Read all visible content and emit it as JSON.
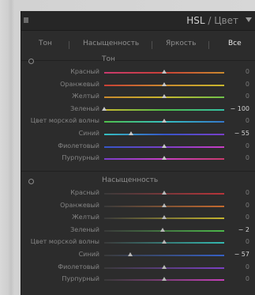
{
  "header": {
    "title": "HSL",
    "separator": "/",
    "subtitle": "Цвет"
  },
  "tabs": [
    {
      "label": "Тон",
      "active": false
    },
    {
      "label": "Насыщенность",
      "active": false
    },
    {
      "label": "Яркость",
      "active": false
    },
    {
      "label": "Все",
      "active": true
    }
  ],
  "sections": [
    {
      "title": "Тон",
      "rows": [
        {
          "label": "Красный",
          "value": "0",
          "level": 0,
          "gradient": [
            "#c93b6e",
            "#c94036",
            "#c98a2e"
          ]
        },
        {
          "label": "Оранжевый",
          "value": "0",
          "level": 0,
          "gradient": [
            "#c94036",
            "#c98a2e",
            "#c9b82e"
          ]
        },
        {
          "label": "Желтый",
          "value": "0",
          "level": 0,
          "gradient": [
            "#c98a2e",
            "#c9b82e",
            "#6fc24a"
          ]
        },
        {
          "label": "Зеленый",
          "value": "− 100",
          "level": -100,
          "gradient": [
            "#c9b82e",
            "#4fbf4a",
            "#35bfa5"
          ]
        },
        {
          "label": "Цвет морской волны",
          "value": "0",
          "level": 0,
          "gradient": [
            "#4fbf4a",
            "#35bfbf",
            "#3577c9"
          ]
        },
        {
          "label": "Синий",
          "value": "− 55",
          "level": -55,
          "gradient": [
            "#35bfbf",
            "#3556c9",
            "#7a3ec9"
          ]
        },
        {
          "label": "Фиолетовый",
          "value": "0",
          "level": 0,
          "gradient": [
            "#3556c9",
            "#7a3ec9",
            "#c93ec4"
          ]
        },
        {
          "label": "Пурпурный",
          "value": "0",
          "level": 0,
          "gradient": [
            "#7a3ec9",
            "#c93ec4",
            "#c93b6e"
          ]
        }
      ]
    },
    {
      "title": "Насыщенность",
      "rows": [
        {
          "label": "Красный",
          "value": "0",
          "level": 0,
          "gradient": [
            "#3a3a3a",
            "#b8343a"
          ]
        },
        {
          "label": "Оранжевый",
          "value": "0",
          "level": 0,
          "gradient": [
            "#3a3a3a",
            "#c46a2e"
          ]
        },
        {
          "label": "Желтый",
          "value": "0",
          "level": 0,
          "gradient": [
            "#3a3a3a",
            "#c4b42e"
          ]
        },
        {
          "label": "Зеленый",
          "value": "− 2",
          "level": -2,
          "gradient": [
            "#3a3a3a",
            "#4cb84a"
          ]
        },
        {
          "label": "Цвет морской волны",
          "value": "0",
          "level": 0,
          "gradient": [
            "#3a3a3a",
            "#34b8b0"
          ]
        },
        {
          "label": "Синий",
          "value": "− 57",
          "level": -57,
          "gradient": [
            "#3a3a3a",
            "#3660c4"
          ]
        },
        {
          "label": "Фиолетовый",
          "value": "0",
          "level": 0,
          "gradient": [
            "#3a3a3a",
            "#7a40c4"
          ]
        },
        {
          "label": "Пурпурный",
          "value": "0",
          "level": 0,
          "gradient": [
            "#3a3a3a",
            "#c440b8"
          ]
        }
      ]
    }
  ]
}
